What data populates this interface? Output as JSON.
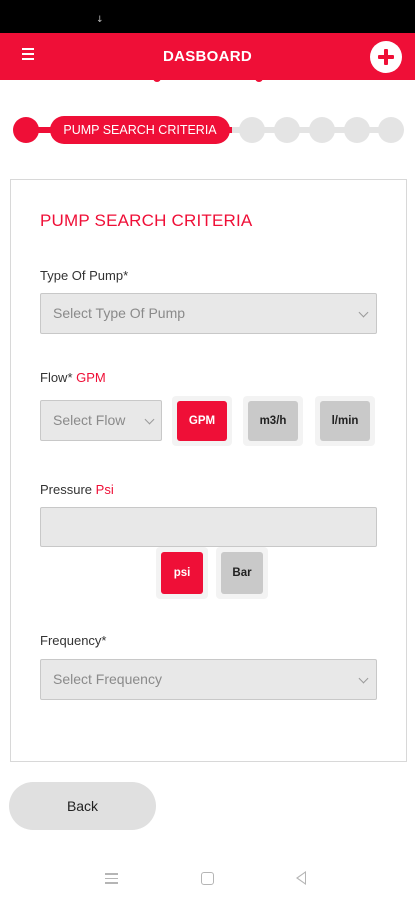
{
  "status_bar": {
    "notification_icon": "download-arrow-icon"
  },
  "app_bar": {
    "title": "DASBOARD",
    "menu_icon": "hamburger-menu-icon",
    "add_icon": "plus-icon",
    "accent_color": "#ef0f37"
  },
  "stepper": {
    "current_step_label": "PUMP SEARCH CRITERIA",
    "total_steps": 7,
    "active_color": "#ef0f37",
    "inactive_color": "#e4e4e4"
  },
  "form": {
    "title": "PUMP SEARCH CRITERIA",
    "pump_type": {
      "label": "Type Of Pump*",
      "placeholder": "Select Type Of Pump"
    },
    "flow": {
      "label": "Flow*",
      "unit_label": "GPM",
      "placeholder": "Select Flow",
      "units": [
        "GPM",
        "m3/h",
        "l/min"
      ],
      "selected_unit": "GPM"
    },
    "pressure": {
      "label": "Pressure",
      "unit_label": "Psi",
      "value": "",
      "units": [
        "psi",
        "Bar"
      ],
      "selected_unit": "psi"
    },
    "frequency": {
      "label": "Frequency*",
      "placeholder": "Select Frequency"
    }
  },
  "back_button": {
    "label": "Back"
  },
  "system_nav": {
    "recents_icon": "recents-icon",
    "home_icon": "home-icon",
    "back_icon": "back-triangle-icon"
  }
}
